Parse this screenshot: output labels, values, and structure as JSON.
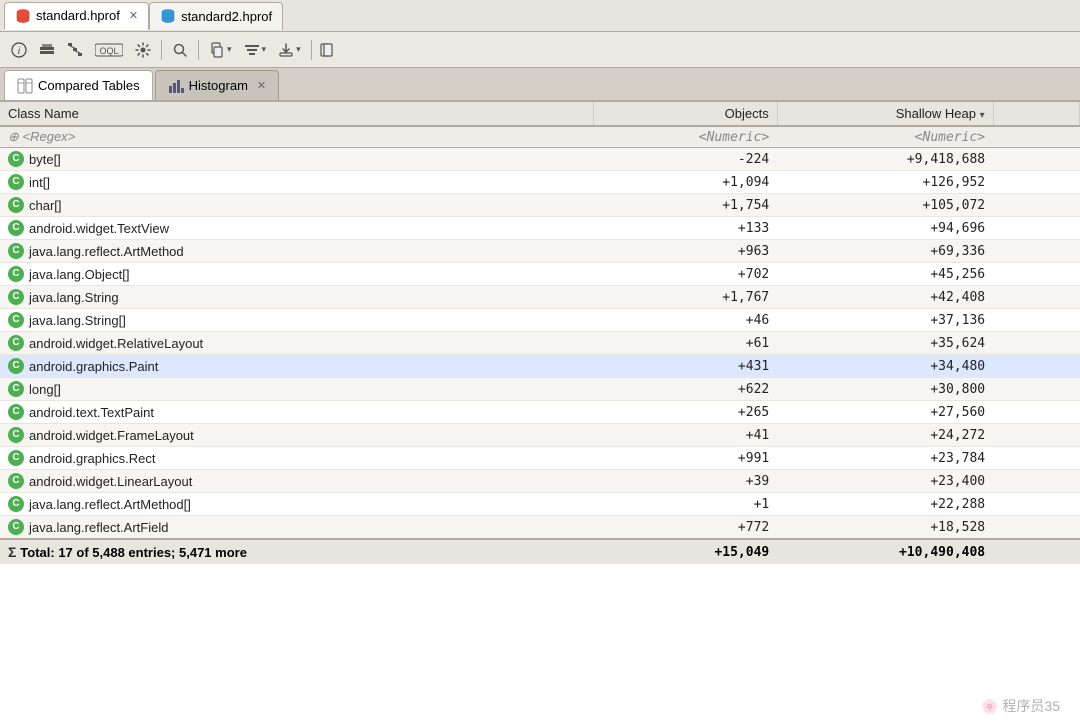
{
  "tabs": [
    {
      "label": "standard.hprof",
      "active": true,
      "closeable": true
    },
    {
      "label": "standard2.hprof",
      "active": false,
      "closeable": false
    }
  ],
  "toolbar": {
    "buttons": [
      {
        "name": "info-btn",
        "icon": "ℹ",
        "label": "Info"
      },
      {
        "name": "heap-btn",
        "icon": "▦",
        "label": "Heap"
      },
      {
        "name": "class-btn",
        "icon": "⊞",
        "label": "Class Hierarchy"
      },
      {
        "name": "sql-btn",
        "icon": "sql",
        "label": "SQL"
      },
      {
        "name": "settings-btn",
        "icon": "⚙",
        "label": "Settings"
      },
      {
        "name": "search-btn",
        "icon": "🔍",
        "label": "Search"
      },
      {
        "name": "copy-btn",
        "icon": "⧉",
        "label": "Copy"
      },
      {
        "name": "filter-btn",
        "icon": "⊟",
        "label": "Filter"
      },
      {
        "name": "export-btn",
        "icon": "↗",
        "label": "Export"
      },
      {
        "name": "heap2-btn",
        "icon": "⊠",
        "label": "Heap2"
      }
    ]
  },
  "view_tabs": [
    {
      "label": "Compared Tables",
      "active": true,
      "icon": "table"
    },
    {
      "label": "Histogram",
      "active": false,
      "icon": "histogram",
      "closeable": true
    }
  ],
  "table": {
    "columns": [
      {
        "key": "class_name",
        "label": "Class Name"
      },
      {
        "key": "objects",
        "label": "Objects"
      },
      {
        "key": "shallow_heap",
        "label": "Shallow Heap",
        "sorted": true,
        "sort_dir": "desc"
      }
    ],
    "filter_row": {
      "class_filter": "<Regex>",
      "objects_filter": "<Numeric>",
      "heap_filter": "<Numeric>"
    },
    "rows": [
      {
        "class": "byte[]",
        "objects": "-224",
        "heap": "+9,418,688",
        "highlight": false
      },
      {
        "class": "int[]",
        "objects": "+1,094",
        "heap": "+126,952",
        "highlight": false
      },
      {
        "class": "char[]",
        "objects": "+1,754",
        "heap": "+105,072",
        "highlight": false
      },
      {
        "class": "android.widget.TextView",
        "objects": "+133",
        "heap": "+94,696",
        "highlight": false
      },
      {
        "class": "java.lang.reflect.ArtMethod",
        "objects": "+963",
        "heap": "+69,336",
        "highlight": false
      },
      {
        "class": "java.lang.Object[]",
        "objects": "+702",
        "heap": "+45,256",
        "highlight": false
      },
      {
        "class": "java.lang.String",
        "objects": "+1,767",
        "heap": "+42,408",
        "highlight": false
      },
      {
        "class": "java.lang.String[]",
        "objects": "+46",
        "heap": "+37,136",
        "highlight": false
      },
      {
        "class": "android.widget.RelativeLayout",
        "objects": "+61",
        "heap": "+35,624",
        "highlight": false
      },
      {
        "class": "android.graphics.Paint",
        "objects": "+431",
        "heap": "+34,480",
        "highlight": true
      },
      {
        "class": "long[]",
        "objects": "+622",
        "heap": "+30,800",
        "highlight": false
      },
      {
        "class": "android.text.TextPaint",
        "objects": "+265",
        "heap": "+27,560",
        "highlight": false
      },
      {
        "class": "android.widget.FrameLayout",
        "objects": "+41",
        "heap": "+24,272",
        "highlight": false
      },
      {
        "class": "android.graphics.Rect",
        "objects": "+991",
        "heap": "+23,784",
        "highlight": false
      },
      {
        "class": "android.widget.LinearLayout",
        "objects": "+39",
        "heap": "+23,400",
        "highlight": false
      },
      {
        "class": "java.lang.reflect.ArtMethod[]",
        "objects": "+1",
        "heap": "+22,288",
        "highlight": false
      },
      {
        "class": "java.lang.reflect.ArtField",
        "objects": "+772",
        "heap": "+18,528",
        "highlight": false
      }
    ],
    "footer": {
      "label": "Total: 17 of 5,488 entries; 5,471 more",
      "objects": "+15,049",
      "heap": "+10,490,408"
    }
  },
  "watermark": "🌸 程序员35"
}
